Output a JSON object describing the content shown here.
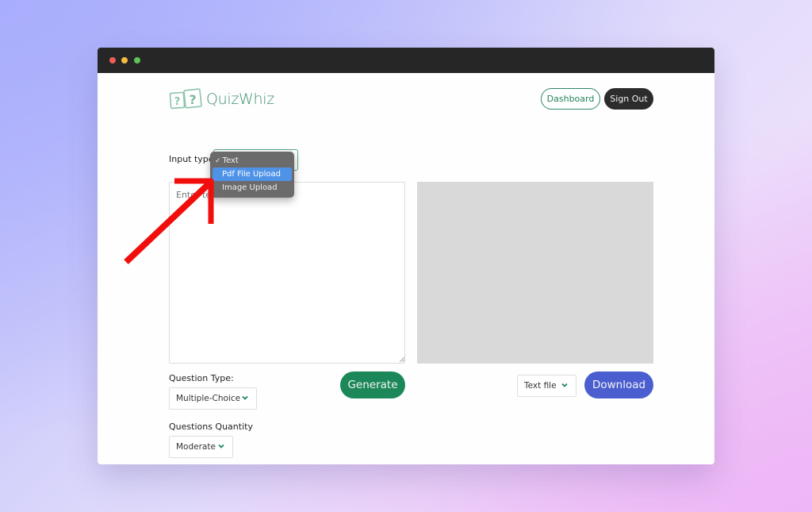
{
  "window": {
    "controls": [
      "close",
      "minimize",
      "maximize"
    ]
  },
  "header": {
    "logo_text": "QuizWhiz",
    "logo_icon": "question-cards-icon",
    "dashboard_label": "Dashboard",
    "signout_label": "Sign Out"
  },
  "input_type": {
    "label": "Input type:",
    "selected": "Text",
    "options": [
      {
        "label": "Text",
        "checked": true,
        "highlighted": false
      },
      {
        "label": "Pdf File Upload",
        "checked": false,
        "highlighted": true
      },
      {
        "label": "Image Upload",
        "checked": false,
        "highlighted": false
      }
    ]
  },
  "textarea": {
    "placeholder": "Enter text",
    "value": ""
  },
  "question_type": {
    "label": "Question Type:",
    "selected": "Multiple-Choice"
  },
  "questions_quantity": {
    "label": "Questions Quantity",
    "selected": "Moderate"
  },
  "output": {
    "file_type_selected": "Text file"
  },
  "actions": {
    "generate_label": "Generate",
    "download_label": "Download"
  },
  "annotation": {
    "type": "arrow",
    "color": "#ff0000",
    "points_to": "Pdf File Upload"
  },
  "colors": {
    "brand_green": "#1c8859",
    "download_blue": "#4a5ed0",
    "titlebar": "#262626",
    "dropdown_highlight": "#4f93e8"
  }
}
